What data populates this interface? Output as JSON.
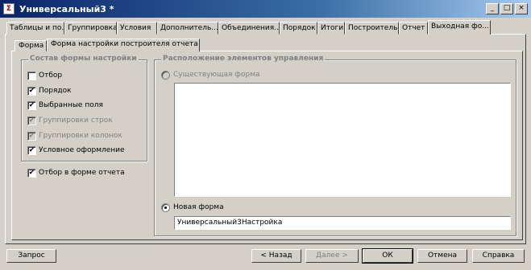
{
  "window": {
    "title": "Универсальный3 *",
    "icon_glyph": "Σ",
    "controls": [
      "_",
      "□",
      "×"
    ]
  },
  "outer_tabs": [
    "Таблицы и по...",
    "Группировка",
    "Условия",
    "Дополнитель...",
    "Объединения...",
    "Порядок",
    "Итоги",
    "Построитель",
    "Отчет",
    "Выходная фо..."
  ],
  "inner_tabs": [
    "Форма",
    "Форма настройки построителя отчета"
  ],
  "settings_group": {
    "title": "Состав формы настройки",
    "items": [
      {
        "label": "Отбор",
        "checked": false,
        "disabled": false
      },
      {
        "label": "Порядок",
        "checked": true,
        "disabled": false
      },
      {
        "label": "Выбранные поля",
        "checked": true,
        "disabled": false
      },
      {
        "label": "Группировки строк",
        "checked": true,
        "disabled": true
      },
      {
        "label": "Группировки колонок",
        "checked": true,
        "disabled": true
      },
      {
        "label": "Условное оформление",
        "checked": true,
        "disabled": false
      }
    ]
  },
  "filter_in_report": {
    "label": "Отбор в форме отчета",
    "checked": true
  },
  "placement_group": {
    "title": "Расположение элементов управления",
    "existing_form_label": "Существующая форма",
    "new_form_label": "Новая форма",
    "new_form_value": "Универсальный3Настройка"
  },
  "buttons": {
    "query": "Запрос",
    "back": "< Назад",
    "next": "Далее >",
    "ok": "ОК",
    "cancel": "Отмена",
    "help": "Справка"
  }
}
